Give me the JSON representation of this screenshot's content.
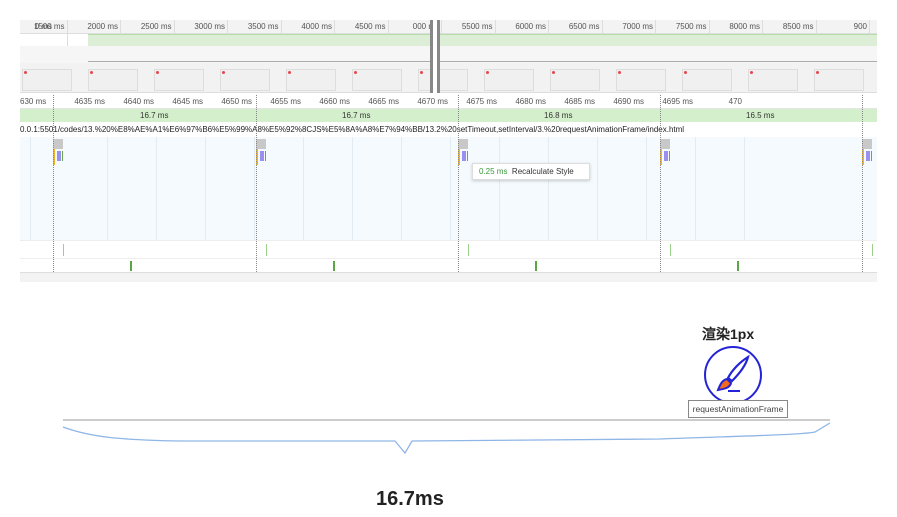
{
  "overview": {
    "ticks": [
      "0 ms",
      "1500 ms",
      "2000 ms",
      "2500 ms",
      "3000 ms",
      "3500 ms",
      "4000 ms",
      "4500 ms",
      "000 ms",
      "5500 ms",
      "6000 ms",
      "6500 ms",
      "7000 ms",
      "7500 ms",
      "8000 ms",
      "8500 ms",
      "900"
    ]
  },
  "detail": {
    "ticks": [
      "630 ms",
      "4635 ms",
      "4640 ms",
      "4645 ms",
      "4650 ms",
      "4655 ms",
      "4660 ms",
      "4665 ms",
      "4670 ms",
      "4675 ms",
      "4680 ms",
      "4685 ms",
      "4690 ms",
      "4695 ms",
      "470"
    ],
    "frames": [
      "16.7 ms",
      "16.7 ms",
      "16.8 ms",
      "16.5 ms"
    ],
    "url": "0.0.1:5501/codes/13.%20%E8%AE%A1%E6%97%B6%E5%99%A8%E5%92%8CJS%E5%8A%A8%E7%94%BB/13.2%20setTimeout,setInterval/3.%20requestAnimationFrame/index.html"
  },
  "tooltip": {
    "duration": "0.25 ms",
    "event": "Recalculate Style"
  },
  "diagram": {
    "title": "渲染1px",
    "icon": "paint-brush-icon",
    "label": "requestAnimationFrame",
    "duration": "16.7ms"
  },
  "colors": {
    "frame_green": "#d4efcb",
    "icon_blue": "#2424d6",
    "brush_orange": "#f26a1b",
    "curve": "#8fb6e6"
  }
}
